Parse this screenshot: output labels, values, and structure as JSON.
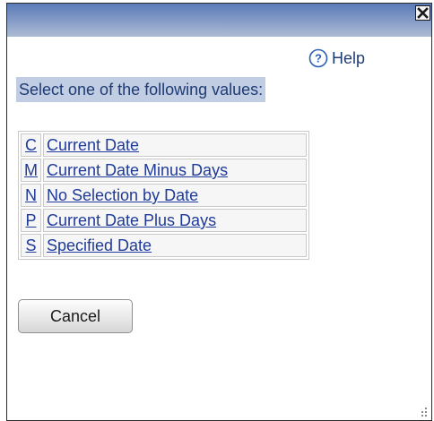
{
  "dialog": {
    "close_icon": "close-icon"
  },
  "help": {
    "icon": "help-icon",
    "icon_glyph": "?",
    "label": "Help"
  },
  "prompt": "Select one of the following values:",
  "values": [
    {
      "code": "C",
      "description": "Current Date"
    },
    {
      "code": "M",
      "description": "Current Date Minus Days"
    },
    {
      "code": "N",
      "description": "No Selection by Date"
    },
    {
      "code": "P",
      "description": "Current Date Plus Days"
    },
    {
      "code": "S",
      "description": "Specified Date"
    }
  ],
  "buttons": {
    "cancel_label": "Cancel"
  },
  "colors": {
    "titlebar_top": "#5a7ab8",
    "titlebar_bottom": "#aebbd4",
    "link": "#1f3b9a",
    "prompt_highlight": "#c0cde3",
    "text": "#1f3b73"
  }
}
